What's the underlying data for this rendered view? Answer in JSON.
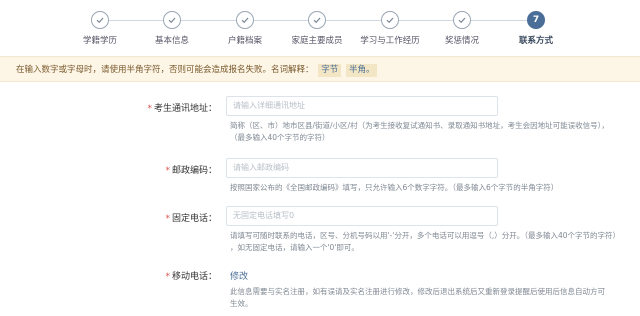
{
  "steps": [
    {
      "label": "学籍学历",
      "state": "done"
    },
    {
      "label": "基本信息",
      "state": "done"
    },
    {
      "label": "户籍档案",
      "state": "done"
    },
    {
      "label": "家庭主要成员",
      "state": "done"
    },
    {
      "label": "学习与工作经历",
      "state": "done"
    },
    {
      "label": "奖惩情况",
      "state": "done"
    },
    {
      "label": "联系方式",
      "state": "active",
      "number": "7"
    }
  ],
  "notice": {
    "text": "在输入数字或字母时，请使用半角字符，否则可能会造成报名失败。名词解释：",
    "tag1": "字节",
    "tag2": "半角。"
  },
  "form": {
    "address": {
      "label": "考生通讯地址：",
      "placeholder": "请输入详细通讯地址",
      "hint1": "简称（区、市）地市区县/街道/小区/村（为考生接收复试通知书、录取通知书地址，考生会因地址可能误收信号），",
      "hint2": "（最多输入40个字节的字符）"
    },
    "zipcode": {
      "label": "邮政编码：",
      "placeholder": "请输入邮政编码",
      "hint1": "按照国家公布的《全国邮政编码》填写，只允许输入6个数字字符。（最多输入6个字节的半角字符）"
    },
    "phone": {
      "label": "固定电话：",
      "placeholder": "无固定电话填写0",
      "hint1": "请填写可随时联系的电话，区号、分机号码以用'-'分开，多个电话可以用逗号（,）分开。（最多输入40个字节的字符）",
      "hint2": "，如无固定电话，请输入一个'0'即可。"
    },
    "mobile": {
      "label": "移动电话：",
      "link": "修改",
      "hint1": "此信息需要与实名注册，如有误请及实名注册进行修改，修改后退出系统后又重新登录提醒后使用后信息自动方可",
      "hint2": "生效。"
    }
  },
  "colors": {
    "accent": "#4a6e98",
    "notice_bg": "#fdf6e6",
    "required": "#d9534f"
  }
}
